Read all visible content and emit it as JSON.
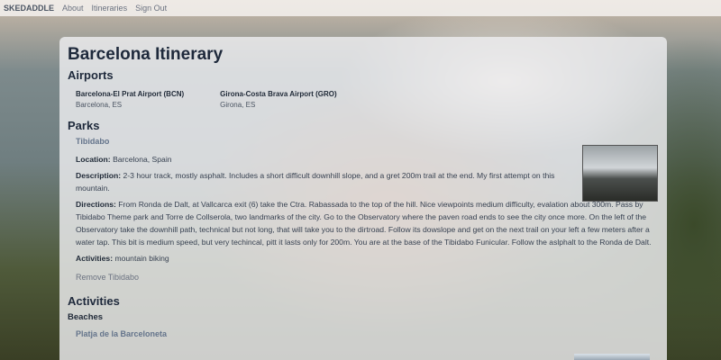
{
  "nav": {
    "brand": "SKEDADDLE",
    "links": [
      "About",
      "Itineraries",
      "Sign Out"
    ]
  },
  "page": {
    "title": "Barcelona Itinerary"
  },
  "airports": {
    "heading": "Airports",
    "items": [
      {
        "name": "Barcelona-El Prat Airport (BCN)",
        "city": "Barcelona, ES"
      },
      {
        "name": "Girona-Costa Brava Airport (GRO)",
        "city": "Girona, ES"
      }
    ]
  },
  "parks": {
    "heading": "Parks",
    "items": [
      {
        "name": "Tibidabo",
        "location_label": "Location:",
        "location": "Barcelona, Spain",
        "description_label": "Description:",
        "description": "2-3 hour track, mostly asphalt. Includes a short difficult downhill slope, and a gret 200m trail at the end. My first attempt on this mountain.",
        "directions_label": "Directions:",
        "directions": "From Ronda de Dalt, at Vallcarca exit (6) take the Ctra. Rabassada to the top of the hill. Nice viewpoints medium difficulty, evalation about 300m. Pass by Tibidabo Theme park and Torre de Collserola, two landmarks of the city. Go to the Observatory where the paven road ends to see the city once more. On the left of the Observatory take the downhill path, technical but not long, that will take you to the dirtroad. Follow its dowslope and get on the next trail on your left a few meters after a water tap. This bit is medium speed, but very techincal, pitt it lasts only for 200m. You are at the base of the Tibidabo Funicular. Follow the aslphalt to the Ronda de Dalt.",
        "activities_label": "Activities:",
        "activities": "mountain biking",
        "remove": "Remove Tibidabo"
      }
    ]
  },
  "activities": {
    "heading": "Activities",
    "category": "Beaches",
    "items": [
      {
        "name": "Platja de la Barceloneta"
      }
    ]
  }
}
